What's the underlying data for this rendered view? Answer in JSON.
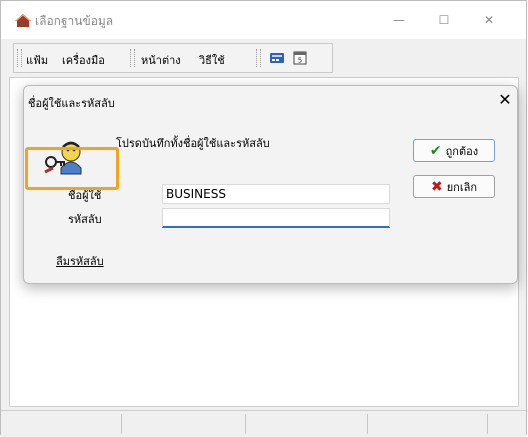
{
  "window": {
    "title": "เลือกฐานข้อมูล",
    "controls": {
      "minimize": "—",
      "maximize": "☐",
      "close": "✕"
    }
  },
  "menu": {
    "items": [
      "แฟ้ม",
      "เครื่องมือ",
      "หน้าต่าง",
      "วิธีใช้"
    ],
    "toolbar_icons": [
      "calculator-icon",
      "calendar-icon"
    ]
  },
  "dialog": {
    "title": "ชื่อผู้ใช้และรหัสลับ",
    "close": "✕",
    "message": "โปรดบันทึกทั้งชื่อผู้ใช้และรหัสลับ",
    "icon": "keys-person-icon",
    "username_label": "ชื่อผู้ใช้",
    "username_value": "BUSINESS",
    "password_label": "รหัสลับ",
    "password_value": "",
    "forgot_link": "ลืมรหัสลับ",
    "ok_button": "ถูกต้อง",
    "cancel_button": "ยกเลิก"
  },
  "colors": {
    "accent": "#2f6fc4",
    "highlight": "#f2a41f",
    "ok_check": "#1a8a1a",
    "cancel_x": "#c0171d"
  }
}
